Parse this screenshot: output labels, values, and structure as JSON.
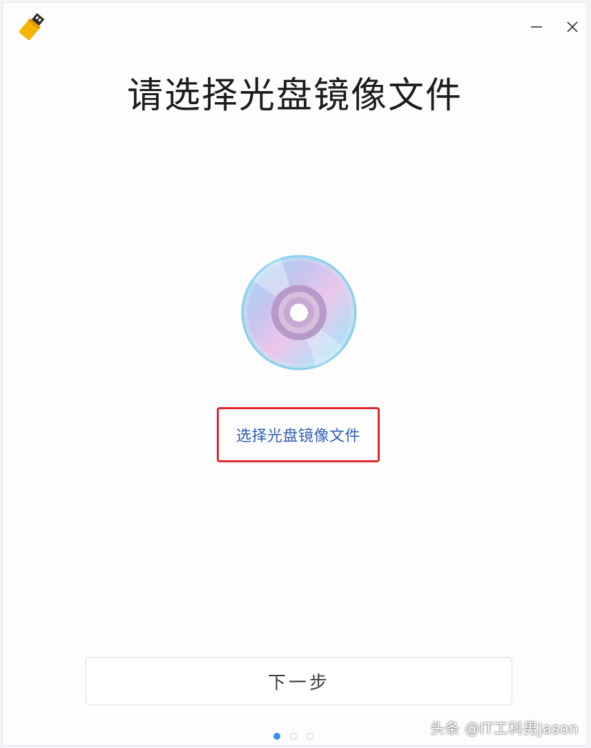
{
  "header": {
    "logo_icon": "usb-drive-icon",
    "minimize_icon": "minimize-icon",
    "close_icon": "close-icon"
  },
  "main": {
    "title": "请选择光盘镜像文件",
    "disc_icon": "disc-icon",
    "select_link_label": "选择光盘镜像文件",
    "highlight_color": "#e0262a",
    "link_color": "#2f5fb0"
  },
  "footer": {
    "next_button_label": "下一步",
    "steps": {
      "total": 3,
      "current": 1
    },
    "dot_active_color": "#3a8ee6"
  },
  "watermark": {
    "text": "头条 @IT工科男Jason"
  }
}
